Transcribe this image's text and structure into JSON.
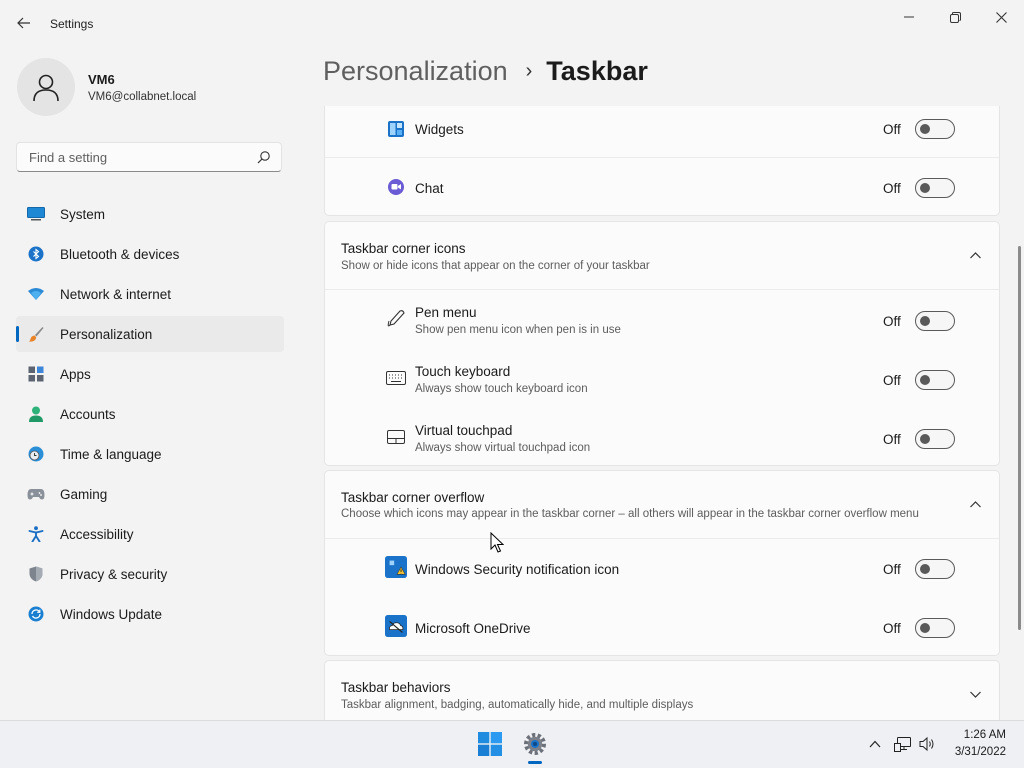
{
  "window": {
    "title": "Settings",
    "back_icon": "back-arrow-icon",
    "controls": [
      "minimize-icon",
      "maximize-icon",
      "close-icon"
    ]
  },
  "user": {
    "name": "VM6",
    "email": "VM6@collabnet.local"
  },
  "search": {
    "placeholder": "Find a setting",
    "value": ""
  },
  "sidebar": {
    "items": [
      {
        "label": "System",
        "icon": "system-icon",
        "active": false
      },
      {
        "label": "Bluetooth & devices",
        "icon": "bluetooth-icon",
        "active": false
      },
      {
        "label": "Network & internet",
        "icon": "wifi-icon",
        "active": false
      },
      {
        "label": "Personalization",
        "icon": "brush-icon",
        "active": true
      },
      {
        "label": "Apps",
        "icon": "apps-icon",
        "active": false
      },
      {
        "label": "Accounts",
        "icon": "accounts-icon",
        "active": false
      },
      {
        "label": "Time & language",
        "icon": "clock-globe-icon",
        "active": false
      },
      {
        "label": "Gaming",
        "icon": "gamepad-icon",
        "active": false
      },
      {
        "label": "Accessibility",
        "icon": "accessibility-icon",
        "active": false
      },
      {
        "label": "Privacy & security",
        "icon": "shield-icon",
        "active": false
      },
      {
        "label": "Windows Update",
        "icon": "update-icon",
        "active": false
      }
    ]
  },
  "breadcrumb": {
    "parent": "Personalization",
    "separator": "›",
    "current": "Taskbar"
  },
  "taskbar_items": [
    {
      "title": "Widgets",
      "state": "Off",
      "icon": "widgets-icon"
    },
    {
      "title": "Chat",
      "state": "Off",
      "icon": "chat-icon"
    }
  ],
  "corner_icons": {
    "title": "Taskbar corner icons",
    "subtitle": "Show or hide icons that appear on the corner of your taskbar",
    "expanded": true,
    "items": [
      {
        "title": "Pen menu",
        "subtitle": "Show pen menu icon when pen is in use",
        "state": "Off",
        "icon": "pen-icon"
      },
      {
        "title": "Touch keyboard",
        "subtitle": "Always show touch keyboard icon",
        "state": "Off",
        "icon": "keyboard-icon"
      },
      {
        "title": "Virtual touchpad",
        "subtitle": "Always show virtual touchpad icon",
        "state": "Off",
        "icon": "touchpad-icon"
      }
    ]
  },
  "corner_overflow": {
    "title": "Taskbar corner overflow",
    "subtitle": "Choose which icons may appear in the taskbar corner – all others will appear in the taskbar corner overflow menu",
    "expanded": true,
    "items": [
      {
        "title": "Windows Security notification icon",
        "state": "Off",
        "icon": "windows-security-icon"
      },
      {
        "title": "Microsoft OneDrive",
        "state": "Off",
        "icon": "onedrive-icon"
      }
    ]
  },
  "behaviors": {
    "title": "Taskbar behaviors",
    "subtitle": "Taskbar alignment, badging, automatically hide, and multiple displays",
    "expanded": false
  },
  "system_taskbar": {
    "time": "1:26 AM",
    "date": "3/31/2022",
    "accent": "#0067c0"
  }
}
